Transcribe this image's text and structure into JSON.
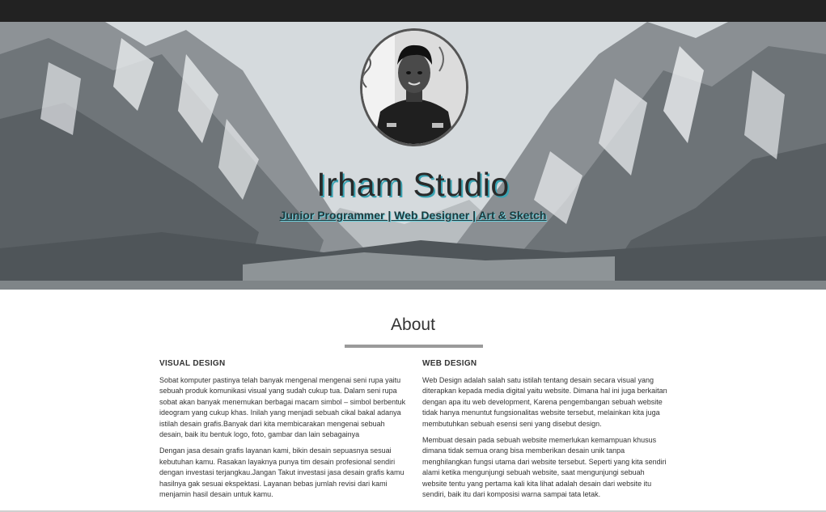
{
  "hero": {
    "title": "Irham Studio",
    "subtitle": "Junior Programmer | Web Designer | Art & Sketch"
  },
  "about": {
    "title": "About",
    "columns": [
      {
        "heading": "VISUAL DESIGN",
        "paragraphs": [
          "Sobat komputer pastinya telah banyak mengenal mengenai seni rupa yaitu sebuah produk komunikasi visual yang sudah cukup tua. Dalam seni rupa sobat akan banyak menemukan berbagai macam simbol – simbol berbentuk ideogram yang cukup khas. Inilah yang menjadi sebuah cikal bakal adanya istilah desain grafis.Banyak dari kita membicarakan mengenai sebuah desain, baik itu bentuk logo, foto, gambar dan lain sebagainya",
          "Dengan jasa desain grafis layanan kami, bikin desain sepuasnya sesuai kebutuhan kamu. Rasakan layaknya punya tim desain profesional sendiri dengan investasi terjangkau.Jangan Takut investasi jasa desain grafis kamu hasilnya gak sesuai ekspektasi. Layanan bebas jumlah revisi dari kami menjamin hasil desain untuk kamu."
        ]
      },
      {
        "heading": "WEB DESIGN",
        "paragraphs": [
          "Web Design adalah salah satu istilah tentang desain secara visual yang diterapkan kepada media digital yaitu website. Dimana hal ini juga berkaitan dengan apa itu web development, Karena pengembangan sebuah website tidak hanya menuntut fungsionalitas website tersebut, melainkan kita juga membutuhkan sebuah esensi seni yang disebut design.",
          "Membuat desain pada sebuah website memerlukan kemampuan khusus dimana tidak semua orang bisa memberikan desain unik tanpa menghilangkan fungsi utama dari website tersebut. Seperti yang kita sendiri alami ketika mengunjungi sebuah website, saat mengunjungi sebuah website tentu yang pertama kali kita lihat adalah desain dari website itu sendiri, baik itu dari komposisi warna sampai tata letak."
        ]
      }
    ]
  }
}
